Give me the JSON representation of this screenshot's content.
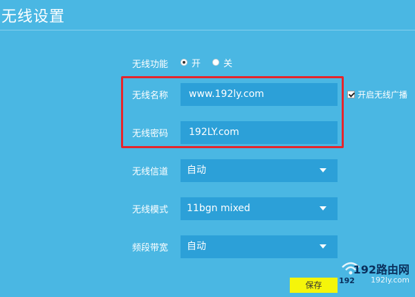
{
  "page": {
    "title": "无线设置"
  },
  "wireless_function": {
    "label": "无线功能",
    "options": [
      "开",
      "关"
    ],
    "selected": "开"
  },
  "ssid": {
    "label": "无线名称",
    "value": "www.192ly.com"
  },
  "broadcast": {
    "label": "开启无线广播",
    "checked": true
  },
  "password": {
    "label": "无线密码",
    "value": "192LY.com"
  },
  "channel": {
    "label": "无线信道",
    "value": "自动"
  },
  "mode": {
    "label": "无线模式",
    "value": "11bgn mixed"
  },
  "bandwidth": {
    "label": "频段带宽",
    "value": "自动"
  },
  "save_label": "保存",
  "watermark": {
    "brand": "192路由网",
    "num": "192",
    "url": "192ly.com"
  },
  "colors": {
    "background": "#4ab7e3",
    "field": "#2ca0d8",
    "highlight": "#e6242b",
    "save": "#f5f50a"
  }
}
